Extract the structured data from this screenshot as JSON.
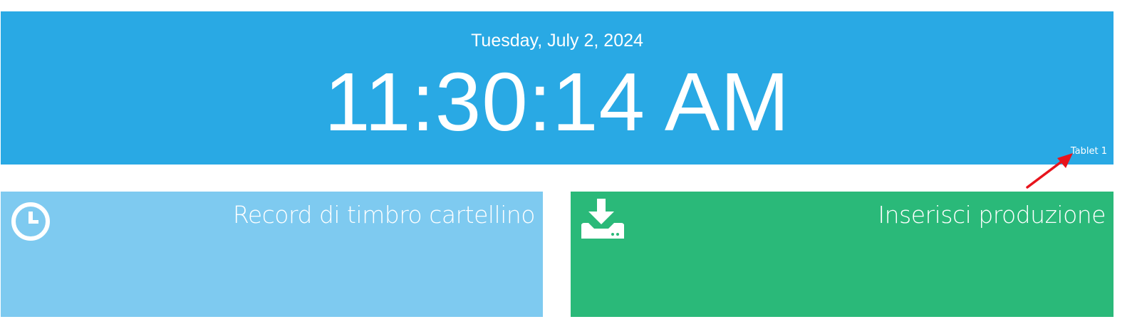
{
  "header": {
    "date": "Tuesday, July 2, 2024",
    "time": "11:30:14 AM",
    "device": "Tablet 1",
    "background_color": "#29a9e4"
  },
  "tiles": [
    {
      "label": "Record di timbro cartellino",
      "icon": "clock-icon",
      "color": "#7ecaf0"
    },
    {
      "label": "Inserisci produzione",
      "icon": "download-tray-icon",
      "color": "#2ab979"
    }
  ],
  "annotation": {
    "icon": "red-arrow-icon",
    "color": "#e8141c"
  }
}
